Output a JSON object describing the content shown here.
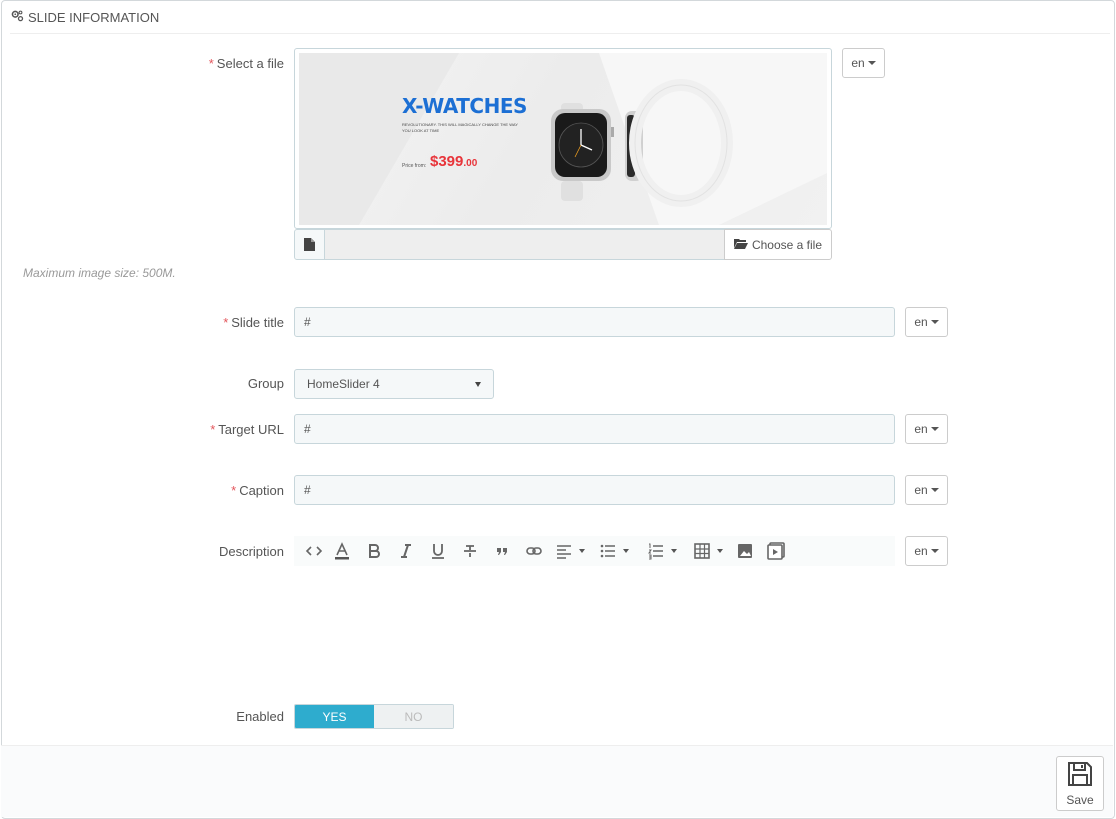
{
  "panel": {
    "title": "SLIDE INFORMATION"
  },
  "lang_code": "en",
  "fields": {
    "file": {
      "label": "Select a file",
      "required_mark": "*",
      "choose_label": "Choose a file",
      "hint": "Maximum image size: 500M."
    },
    "slide_title": {
      "label": "Slide title",
      "required_mark": "*",
      "value": "#"
    },
    "group": {
      "label": "Group",
      "selected": "HomeSlider 4"
    },
    "target_url": {
      "label": "Target URL",
      "required_mark": "*",
      "value": "#"
    },
    "caption": {
      "label": "Caption",
      "required_mark": "*",
      "value": "#"
    },
    "description": {
      "label": "Description"
    },
    "enabled": {
      "label": "Enabled",
      "yes": "YES",
      "no": "NO",
      "value": "YES"
    }
  },
  "banner": {
    "title": "X-WATCHES",
    "subtitle": "REVOLUTIONARY. THIS WILL MAGICALLY CHANGE THE WAY YOU LOOK AT TIME",
    "price_label": "Price from:",
    "price": "$399",
    "price_cents": ".00"
  },
  "toolbar": {
    "tools": [
      "code-view-icon",
      "font-color-icon",
      "bold-icon",
      "italic-icon",
      "underline-icon",
      "strikethrough-icon",
      "blockquote-icon",
      "link-icon",
      "align-icon",
      "unordered-list-icon",
      "ordered-list-icon",
      "table-icon",
      "image-icon",
      "video-icon"
    ]
  },
  "footer": {
    "save_label": "Save"
  },
  "colors": {
    "accent": "#2eacce",
    "required": "#e3555b",
    "brand_blue": "#1c6fd4",
    "price_red": "#e8343a"
  }
}
